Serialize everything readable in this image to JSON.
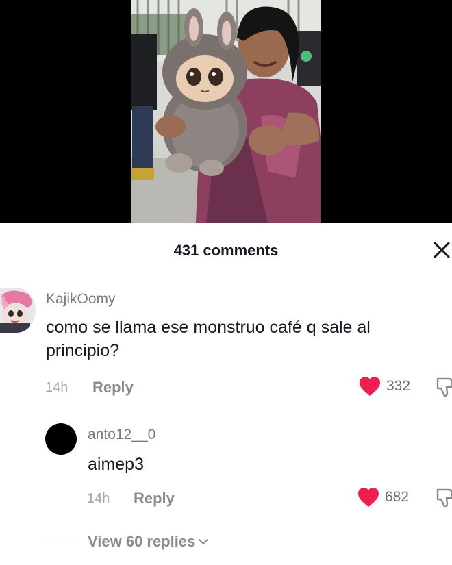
{
  "sheet": {
    "comment_count": "431 comments"
  },
  "comments": [
    {
      "username": "KajikOomy",
      "text": "como se llama ese monstruo café q sale al principio?",
      "time": "14h",
      "reply_label": "Reply",
      "likes": "332",
      "liked": true
    }
  ],
  "reply": {
    "username": "anto12__0",
    "text": "aimep3",
    "time": "14h",
    "reply_label": "Reply",
    "likes": "682",
    "liked": true
  },
  "view_replies": {
    "label": "View 60 replies"
  },
  "colors": {
    "like_red": "#ee1d52",
    "muted_text": "#8a8b91",
    "primary_text": "#161823"
  },
  "icons": [
    "close-icon",
    "heart-icon",
    "dislike-icon",
    "chevron-down-icon"
  ]
}
